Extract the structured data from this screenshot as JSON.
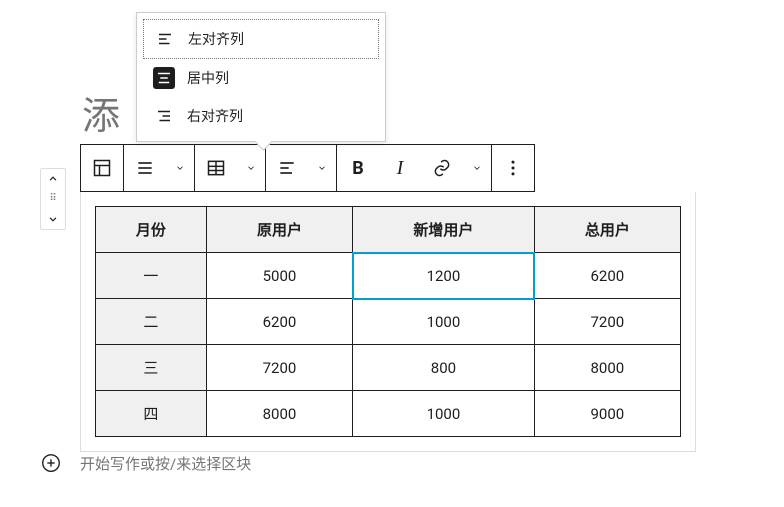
{
  "title_placeholder": "添",
  "toolbar": {
    "bold": "B",
    "italic": "I"
  },
  "dropdown": {
    "left_align": "左对齐列",
    "center": "居中列",
    "right_align": "右对齐列"
  },
  "table": {
    "headers": [
      "月份",
      "原用户",
      "新增用户",
      "总用户"
    ],
    "rows": [
      [
        "一",
        "5000",
        "1200",
        "6200"
      ],
      [
        "二",
        "6200",
        "1000",
        "7200"
      ],
      [
        "三",
        "7200",
        "800",
        "8000"
      ],
      [
        "四",
        "8000",
        "1000",
        "9000"
      ]
    ],
    "selected_cell": [
      0,
      2
    ]
  },
  "appender": {
    "placeholder": "开始写作或按/来选择区块"
  },
  "chart_data": {
    "type": "table",
    "title": "",
    "headers": [
      "月份",
      "原用户",
      "新增用户",
      "总用户"
    ],
    "rows": [
      {
        "月份": "一",
        "原用户": 5000,
        "新增用户": 1200,
        "总用户": 6200
      },
      {
        "月份": "二",
        "原用户": 6200,
        "新增用户": 1000,
        "总用户": 7200
      },
      {
        "月份": "三",
        "原用户": 7200,
        "新增用户": 800,
        "总用户": 8000
      },
      {
        "月份": "四",
        "原用户": 8000,
        "新增用户": 1000,
        "总用户": 9000
      }
    ]
  }
}
